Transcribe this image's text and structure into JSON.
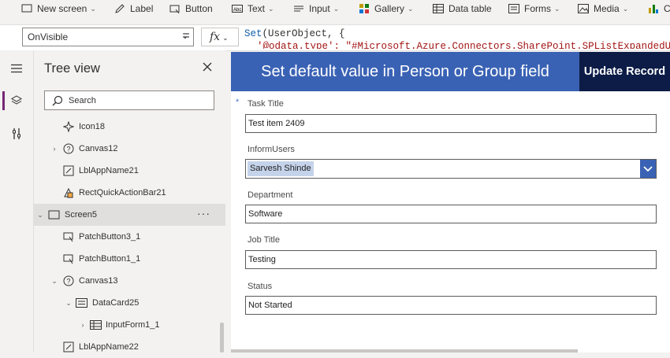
{
  "toolbar": {
    "items": [
      {
        "label": "New screen",
        "icon": "new-screen-icon",
        "has_dropdown": true
      },
      {
        "label": "Label",
        "icon": "label-icon",
        "has_dropdown": false
      },
      {
        "label": "Button",
        "icon": "button-icon",
        "has_dropdown": false
      },
      {
        "label": "Text",
        "icon": "text-icon",
        "has_dropdown": true
      },
      {
        "label": "Input",
        "icon": "input-icon",
        "has_dropdown": true
      },
      {
        "label": "Gallery",
        "icon": "gallery-icon",
        "has_dropdown": true
      },
      {
        "label": "Data table",
        "icon": "data-table-icon",
        "has_dropdown": false
      },
      {
        "label": "Forms",
        "icon": "forms-icon",
        "has_dropdown": true
      },
      {
        "label": "Media",
        "icon": "media-icon",
        "has_dropdown": true
      },
      {
        "label": "C",
        "icon": "chart-icon",
        "has_dropdown": false
      }
    ]
  },
  "formula_bar": {
    "property": "OnVisible",
    "equals": "=",
    "fx": "fx",
    "line1_fn": "Set",
    "line1_rest": "(UserObject, {",
    "line2": "'@odata.type': \"#Microsoft.Azure.Connectors.SharePoint.SPListExpandedUser"
  },
  "tree_view": {
    "title": "Tree view",
    "search_placeholder": "Search",
    "nodes": [
      {
        "label": "Icon18",
        "icon": "icon-control-icon"
      },
      {
        "label": "Canvas12",
        "icon": "canvas-icon"
      },
      {
        "label": "LblAppName21",
        "icon": "label-control-icon"
      },
      {
        "label": "RectQuickActionBar21",
        "icon": "rectangle-icon"
      },
      {
        "label": "Screen5",
        "icon": "screen-icon"
      },
      {
        "label": "PatchButton3_1",
        "icon": "button-control-icon"
      },
      {
        "label": "PatchButton1_1",
        "icon": "button-control-icon"
      },
      {
        "label": "Canvas13",
        "icon": "canvas-icon"
      },
      {
        "label": "DataCard25",
        "icon": "data-card-icon"
      },
      {
        "label": "InputForm1_1",
        "icon": "form-icon"
      },
      {
        "label": "LblAppName22",
        "icon": "label-control-icon"
      }
    ],
    "selected": "Screen5",
    "more": "···"
  },
  "canvas": {
    "header_title": "Set default value in Person or Group field",
    "update_button": "Update Record",
    "required_marker": "*",
    "fields": [
      {
        "label": "Task Title",
        "value": "Test item 2409"
      },
      {
        "label": "InformUsers",
        "value": "Sarvesh Shinde"
      },
      {
        "label": "Department",
        "value": "Software"
      },
      {
        "label": "Job Title",
        "value": "Testing"
      },
      {
        "label": "Status",
        "value": "Not Started"
      }
    ]
  },
  "colors": {
    "header_blue": "#3a62b4",
    "update_button_navy": "#0c1c47",
    "accent_purple": "#742774"
  }
}
